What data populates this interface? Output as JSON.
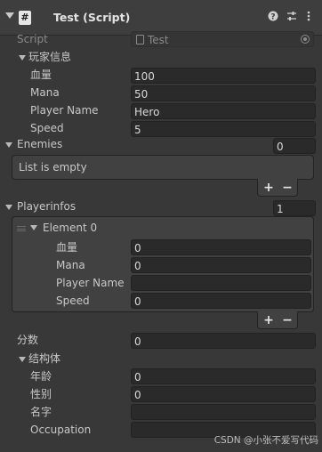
{
  "header": {
    "title": "Test (Script)",
    "script_glyph": "#",
    "help_icon": "help-icon",
    "settings_icon": "sliders-icon",
    "menu_icon": "kebab-menu-icon"
  },
  "script_row": {
    "label": "Script",
    "value": "Test"
  },
  "player_info": {
    "label": "玩家信息",
    "fields": [
      {
        "label": "血量",
        "value": "100"
      },
      {
        "label": "Mana",
        "value": "50"
      },
      {
        "label": "Player Name",
        "value": "Hero"
      },
      {
        "label": "Speed",
        "value": "5"
      }
    ]
  },
  "enemies": {
    "label": "Enemies",
    "count": "0",
    "empty_text": "List is empty",
    "add_label": "+",
    "remove_label": "−"
  },
  "playerinfos": {
    "label": "Playerinfos",
    "count": "1",
    "element_label": "Element 0",
    "fields": [
      {
        "label": "血量",
        "value": "0"
      },
      {
        "label": "Mana",
        "value": "0"
      },
      {
        "label": "Player Name",
        "value": ""
      },
      {
        "label": "Speed",
        "value": "0"
      }
    ],
    "add_label": "+",
    "remove_label": "−"
  },
  "score": {
    "label": "分数",
    "value": "0"
  },
  "struct": {
    "label": "结构体",
    "fields": [
      {
        "label": "年龄",
        "value": "0"
      },
      {
        "label": "性别",
        "value": "0"
      },
      {
        "label": "名字",
        "value": ""
      },
      {
        "label": "Occupation",
        "value": ""
      }
    ]
  },
  "watermark": "CSDN @小张不爱写代码",
  "colors": {
    "background": "#383838",
    "header": "#3e3e3e",
    "field": "#2a2a2a",
    "list_box": "#414141",
    "text": "#d2d2d2"
  }
}
